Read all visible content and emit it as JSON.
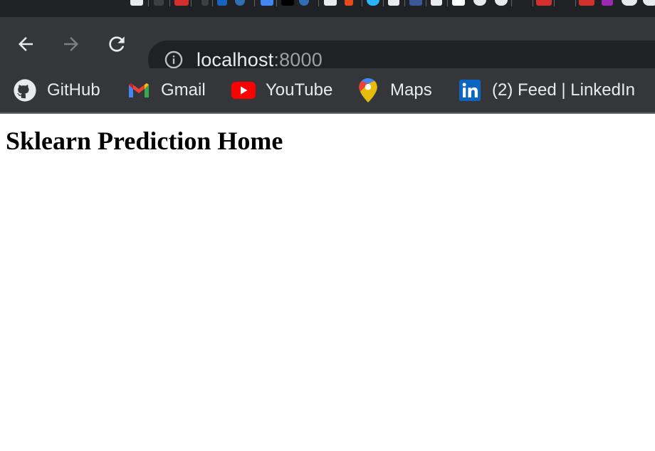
{
  "browser": {
    "address_bar": {
      "host": "localhost",
      "port": ":8000"
    },
    "bookmarks": [
      {
        "label": "GitHub",
        "icon": "github-icon"
      },
      {
        "label": "Gmail",
        "icon": "gmail-icon"
      },
      {
        "label": "YouTube",
        "icon": "youtube-icon"
      },
      {
        "label": "Maps",
        "icon": "maps-icon"
      },
      {
        "label": "(2) Feed | LinkedIn",
        "icon": "linkedin-icon"
      }
    ],
    "colors": {
      "toolbar_bg": "#35363a",
      "tabstrip_bg": "#202124",
      "omnibox_bg": "#202124",
      "text": "#e8eaed",
      "muted_text": "#9aa0a6"
    }
  },
  "page": {
    "title": "Sklearn Prediction Home"
  }
}
